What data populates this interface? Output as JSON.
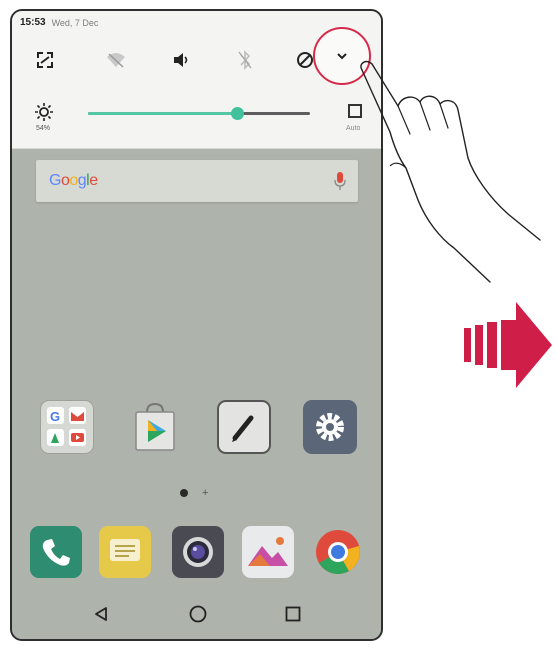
{
  "status_bar": {
    "time": "15:53",
    "date": "Wed, 7 Dec"
  },
  "quick_settings": {
    "icons": [
      "screen-rotation-icon",
      "wifi-off-icon",
      "sound-icon",
      "bluetooth-off-icon",
      "do-not-disturb-icon"
    ],
    "expand_icon": "chevron-down-icon"
  },
  "brightness": {
    "percent_label": "54%",
    "level_percent": 67,
    "auto_label": "Auto"
  },
  "search": {
    "logo_text": "Google",
    "logo_colors": [
      "#5f86ff",
      "#e04a3c",
      "#f2b21f",
      "#5f86ff",
      "#2ea55c",
      "#e04a3c"
    ]
  },
  "home_apps": [
    "google-folder-icon",
    "play-store-icon",
    "notes-icon",
    "settings-icon"
  ],
  "dock_apps": [
    "phone-icon",
    "messages-icon",
    "camera-icon",
    "gallery-icon",
    "chrome-icon"
  ],
  "colors": {
    "accent": "#41c29c",
    "highlight_circle": "#d52a4a",
    "arrow": "#cf1f48"
  }
}
